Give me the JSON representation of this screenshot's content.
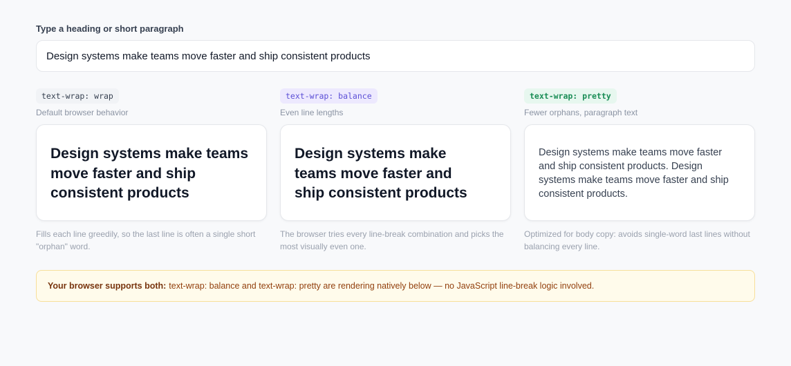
{
  "input": {
    "label": "Type a heading or short paragraph",
    "value": "Design systems make teams move faster and ship consistent products"
  },
  "columns": [
    {
      "tag": "text-wrap: wrap",
      "description": "Default browser behavior",
      "preview_lines": [
        "Design systems make teams",
        "move faster and ship",
        "consistent products"
      ],
      "note": "Fills each line greedily, so the last line is often a single short \"orphan\" word."
    },
    {
      "tag": "text-wrap: balance",
      "description": "Even line lengths",
      "preview_lines": [
        "Design systems make",
        "teams move faster and",
        "ship consistent products"
      ],
      "note": "The browser tries every line-break combination and picks the most visually even one."
    },
    {
      "tag": "text-wrap: pretty",
      "description": "Fewer orphans, paragraph text",
      "preview_text": "Design systems make teams move faster and ship consistent products. Design systems make teams move faster and ship consistent products.",
      "note": "Optimized for body copy: avoids single-word last lines without balancing every line."
    }
  ],
  "banner": {
    "strong": "Your browser supports both:",
    "text": "text-wrap: balance and text-wrap: pretty are rendering natively below — no JavaScript line-break logic involved."
  },
  "colors": {
    "page_bg": "#f8f9fb",
    "balance_tag": "#5b4fd6",
    "pretty_tag": "#1a8d56",
    "banner_bg": "#fffbeb"
  }
}
